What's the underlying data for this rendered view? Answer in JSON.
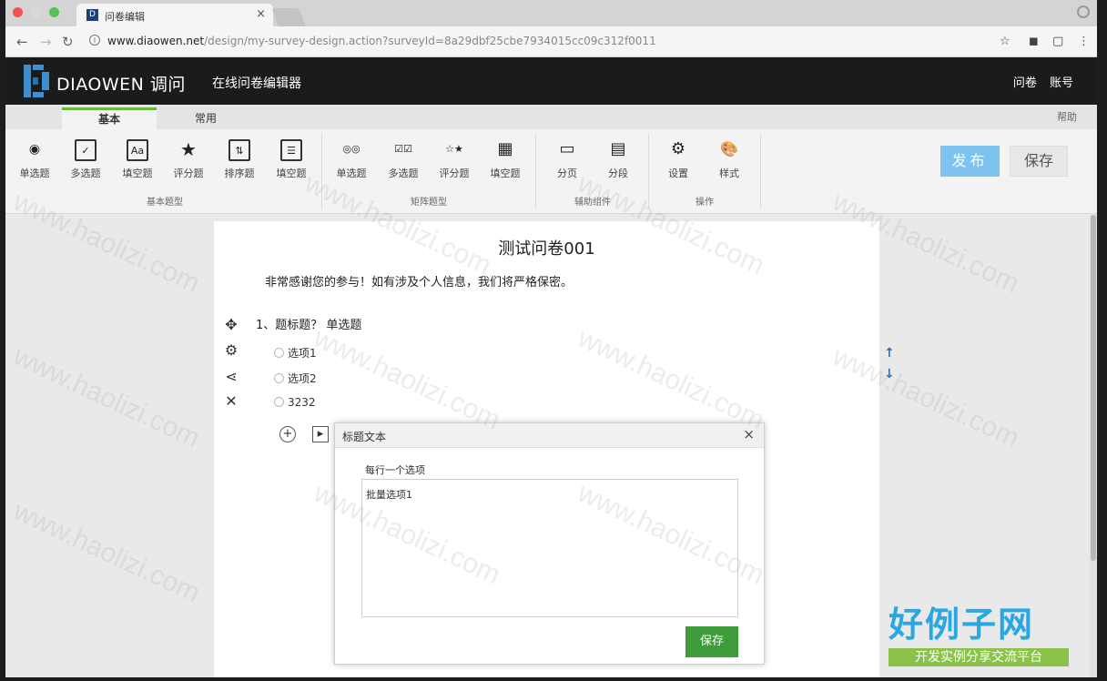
{
  "browser": {
    "tab_title": "问卷编辑",
    "tab_favicon": "D",
    "tab_close": "×",
    "url_host": "www.diaowen.net",
    "url_path": "/design/my-survey-design.action?surveyId=8a29dbf25cbe7934015cc09c312f0011"
  },
  "header": {
    "brand": "DIAOWEN 调问",
    "subtitle": "在线问卷编辑器",
    "nav_survey": "问卷",
    "nav_account": "账号"
  },
  "ribbon": {
    "tabs": [
      "基本",
      "常用"
    ],
    "help": "帮助",
    "tools": [
      {
        "label": "单选题",
        "icon": "radio-icon",
        "glyph": "◉"
      },
      {
        "label": "多选题",
        "icon": "checkbox-icon",
        "glyph": "✓"
      },
      {
        "label": "填空题",
        "icon": "text-input-icon",
        "glyph": "Aa"
      },
      {
        "label": "评分题",
        "icon": "star-icon",
        "glyph": "★"
      },
      {
        "label": "排序题",
        "icon": "sort-icon",
        "glyph": "⇅"
      },
      {
        "label": "填空题",
        "icon": "multi-fill-icon",
        "glyph": "☰"
      },
      {
        "label": "单选题",
        "icon": "matrix-radio-icon",
        "glyph": "◎◎"
      },
      {
        "label": "多选题",
        "icon": "matrix-checkbox-icon",
        "glyph": "☑☑"
      },
      {
        "label": "评分题",
        "icon": "matrix-star-icon",
        "glyph": "☆★"
      },
      {
        "label": "填空题",
        "icon": "matrix-fill-icon",
        "glyph": "▦"
      },
      {
        "label": "分页",
        "icon": "page-break-icon",
        "glyph": "▭"
      },
      {
        "label": "分段",
        "icon": "section-icon",
        "glyph": "▤"
      },
      {
        "label": "设置",
        "icon": "settings-icon",
        "glyph": "⚙"
      },
      {
        "label": "样式",
        "icon": "palette-icon",
        "glyph": "🎨"
      }
    ],
    "groups": [
      "基本题型",
      "矩阵题型",
      "辅助组件",
      "操作"
    ],
    "publish": "发布",
    "save": "保存"
  },
  "survey": {
    "title": "测试问卷001",
    "description": "非常感谢您的参与！如有涉及个人信息，我们将严格保密。",
    "question": "1、题标题？ 单选题",
    "options": [
      "选项1",
      "选项2",
      "3232"
    ]
  },
  "popup": {
    "title": "标题文本",
    "close": "×",
    "hint": "每行一个选项",
    "text": "批量选项1",
    "save": "保存"
  },
  "watermark": {
    "text": "www.haolizi.com",
    "badge_big": "好例子网",
    "badge_small": "开发实例分享交流平台"
  }
}
